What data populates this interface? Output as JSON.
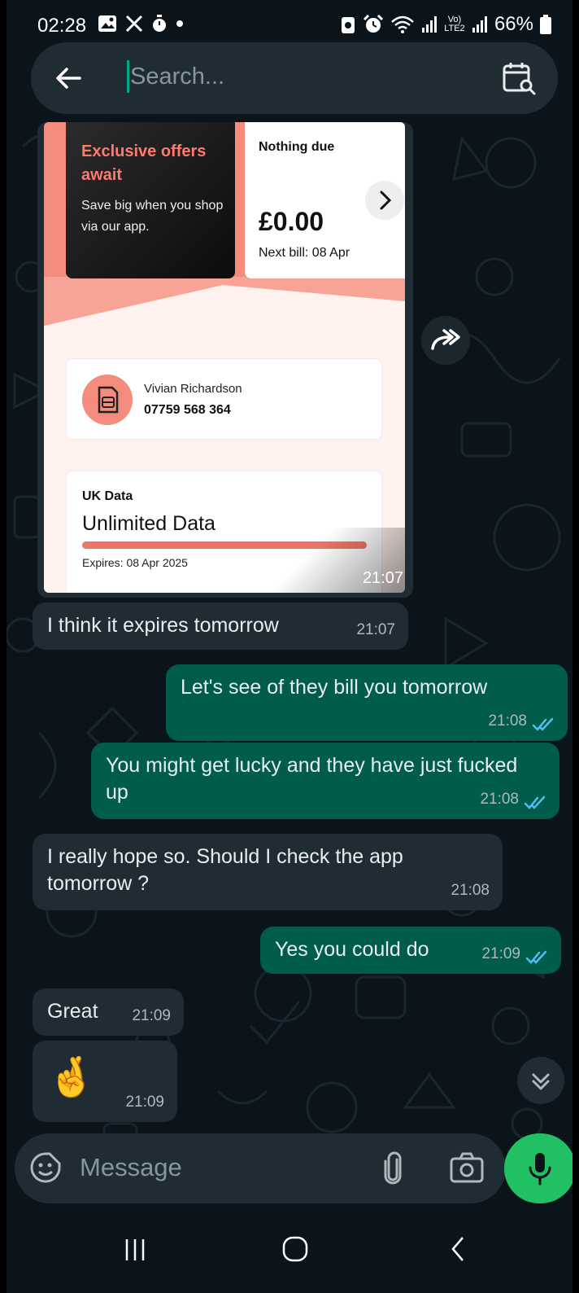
{
  "status_bar": {
    "time": "02:28",
    "battery": "66%",
    "network": "Vo) LTE2"
  },
  "search": {
    "placeholder": "Search..."
  },
  "image_message": {
    "promo_title": "Exclusive offers await",
    "promo_subtitle": "Save big when you shop via our app.",
    "bill_title": "Nothing due",
    "bill_amount": "£0.00",
    "bill_next": "Next bill: 08 Apr",
    "sim_name": "Vivian Richardson",
    "sim_number": "07759 568 364",
    "data_title": "UK Data",
    "data_plan": "Unlimited Data",
    "data_usage_fraction": 1.0,
    "data_expires": "Expires: 08 Apr 2025",
    "time": "21:07"
  },
  "messages": [
    {
      "direction": "in",
      "text": "I think it expires tomorrow",
      "time": "21:07"
    },
    {
      "direction": "out",
      "text": "Let's see of they bill you tomorrow",
      "time": "21:08",
      "read": true
    },
    {
      "direction": "out",
      "text": "You might get lucky and they have just fucked up",
      "time": "21:08",
      "read": true
    },
    {
      "direction": "in",
      "text": "I really hope so. Should I check the app tomorrow ?",
      "time": "21:08"
    },
    {
      "direction": "out",
      "text": "Yes you could do",
      "time": "21:09",
      "read": true
    },
    {
      "direction": "in",
      "text": "Great",
      "time": "21:09"
    },
    {
      "direction": "in",
      "text": "🤞",
      "time": "21:09"
    }
  ],
  "compose": {
    "placeholder": "Message"
  },
  "colors": {
    "background": "#0b141a",
    "incoming_bubble": "#202c33",
    "outgoing_bubble": "#005c4b",
    "accent": "#21c063",
    "read_ticks": "#53bdeb"
  }
}
